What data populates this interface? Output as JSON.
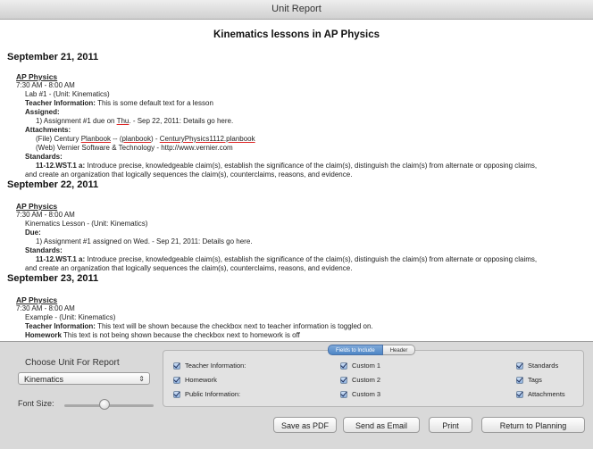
{
  "window": {
    "title": "Unit Report"
  },
  "report": {
    "title": "Kinematics lessons in AP Physics",
    "days": [
      {
        "date": "September 21, 2011",
        "course": "AP Physics",
        "time": "7:30 AM - 8:00 AM",
        "lesson": "Lab #1 - (Unit: Kinematics)",
        "teacher_label": "Teacher Information:",
        "teacher_text": "This is some default text for a lesson",
        "assigned_label": "Assigned:",
        "assigned_pre": "1) Assignment #1 due on ",
        "assigned_link": "Thu",
        "assigned_post": ". - Sep 22, 2011: Details go here.",
        "attachments_label": "Attachments:",
        "att1_pre": "(File) Century ",
        "att1_link1": "Planbook",
        "att1_mid": " -- (",
        "att1_link2": "planbook",
        "att1_mid2": ") - ",
        "att1_link3": "CenturyPhysics1112.planbook",
        "att2": "(Web) Vernier Software & Technology - http://www.vernier.com",
        "standards_label": "Standards:",
        "std_code": "11-12.WST.1 a:",
        "std_text": " Introduce precise, knowledgeable claim(s), establish the significance of the claim(s), distinguish the claim(s) from alternate or opposing claims,",
        "std_text2": "and create an organization that logically sequences the claim(s), counterclaims, reasons, and evidence."
      },
      {
        "date": "September 22, 2011",
        "course": "AP Physics",
        "time": "7:30 AM - 8:00 AM",
        "lesson": "Kinematics Lesson - (Unit: Kinematics)",
        "due_label": "Due:",
        "due_text": "1) Assignment #1 assigned on Wed. - Sep 21, 2011: Details go here.",
        "standards_label": "Standards:",
        "std_code": "11-12.WST.1 a:",
        "std_text": " Introduce precise, knowledgeable claim(s), establish the significance of the claim(s), distinguish the claim(s) from alternate or opposing claims,",
        "std_text2": "and create an organization that logically sequences the claim(s), counterclaims, reasons, and evidence."
      },
      {
        "date": "September 23, 2011",
        "course": "AP Physics",
        "time": "7:30 AM - 8:00 AM",
        "lesson": "Example - (Unit: Kinematics)",
        "teacher_label": "Teacher Information:",
        "teacher_text": "This text will be shown because the checkbox next to teacher information  is toggled on.",
        "homework_label": "Homework",
        "homework_text": "This text is not being shown because the checkbox next to homework is off"
      }
    ]
  },
  "controls": {
    "choose_label": "Choose Unit For Report",
    "unit_selected": "Kinematics",
    "font_size_label": "Font Size:",
    "font_size_level": 0.45,
    "tabs": [
      "Fields to Include",
      "Header"
    ],
    "options": [
      "Teacher Information:",
      "Homework",
      "Public Information:",
      "Custom 1",
      "Custom 2",
      "Custom 3",
      "Standards",
      "Tags",
      "Attachments"
    ]
  },
  "buttons": {
    "save_pdf": "Save as PDF",
    "send_email": "Send as Email",
    "print": "Print",
    "return": "Return to Planning"
  }
}
